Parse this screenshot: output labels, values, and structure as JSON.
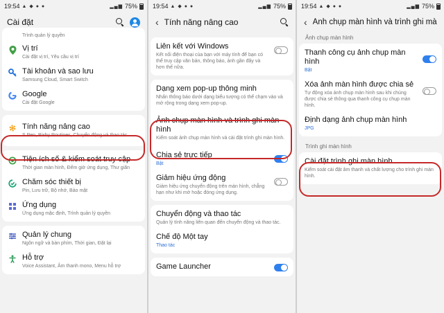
{
  "colors": {
    "highlight": "#c62828",
    "toggle_on": "#2f80ed",
    "subtitle_blue": "#2a6fd6"
  },
  "panels": [
    {
      "status": {
        "time": "19:54",
        "battery": "75%"
      },
      "header": {
        "title": "Cài đặt"
      },
      "items": [
        {
          "title": "",
          "subtitle": "Trình quản lý quyền"
        },
        {
          "title": "Vị trí",
          "subtitle": "Cài đặt vị trí, Yêu cầu vị trí",
          "icon": "location-icon"
        },
        {
          "title": "Tài khoản và sao lưu",
          "subtitle": "Samsung Cloud, Smart Switch",
          "icon": "key-icon"
        },
        {
          "title": "Google",
          "subtitle": "Cài đặt Google",
          "icon": "google-icon"
        },
        {
          "title": "Tính năng nâng cao",
          "subtitle": "S Pen, Bixby Routines, Chuyển động và thao tác",
          "icon": "advanced-features-icon"
        },
        {
          "title": "Tiện ích số & kiểm soát truy cập",
          "subtitle": "Thời gian màn hình, Đếm giờ ứng dụng, Thư giãn",
          "icon": "digital-wellbeing-icon"
        },
        {
          "title": "Chăm sóc thiết bị",
          "subtitle": "Pin, Lưu trữ, Bộ nhớ, Bảo mật",
          "icon": "device-care-icon"
        },
        {
          "title": "Ứng dụng",
          "subtitle": "Ứng dụng mặc định, Trình quản lý quyền",
          "icon": "apps-icon"
        },
        {
          "title": "Quản lý chung",
          "subtitle": "Ngôn ngữ và bàn phím, Thời gian, Đặt lại",
          "icon": "general-management-icon"
        },
        {
          "title": "Hỗ trợ",
          "subtitle": "Voice Assistant, Âm thanh mono, Menu hỗ trợ",
          "icon": "accessibility-icon"
        }
      ]
    },
    {
      "status": {
        "time": "19:54",
        "battery": "75%"
      },
      "header": {
        "title": "Tính năng nâng cao"
      },
      "items": [
        {
          "title": "Liên kết với Windows",
          "subtitle": "Kết nối điện thoại của bạn với máy tính để bạn có thể truy cập văn bản, thông báo, ảnh gần đây và hơn thế nữa."
        },
        {
          "title": "Dạng xem pop-up thông minh",
          "subtitle": "Nhấn thông báo dưới dạng biểu tượng có thể chạm vào và mở rộng trong dạng xem pop-up."
        },
        {
          "title": "Ảnh chụp màn hình và trình ghi màn hình",
          "subtitle": "Kiểm soát ảnh chụp màn hình và cài đặt trình ghi màn hình."
        },
        {
          "title": "Chia sẻ trực tiếp",
          "subtitle": "Bật"
        },
        {
          "title": "Giảm hiệu ứng động",
          "subtitle": "Giảm hiệu ứng chuyển động trên màn hình, chẳng hạn như khi mở hoặc đóng ứng dụng."
        },
        {
          "title": "Chuyển động và thao tác",
          "subtitle": "Quản lý tính năng liên quan đến chuyển động và thao tác."
        },
        {
          "title": "Chế độ Một tay",
          "subtitle": "Thao tác"
        },
        {
          "title": "Game Launcher",
          "subtitle": ""
        }
      ]
    },
    {
      "status": {
        "time": "19:54",
        "battery": "75%"
      },
      "header": {
        "title": "Ảnh chụp màn hình và trình ghi màn hình"
      },
      "sections": [
        {
          "label": "Ảnh chụp màn hình",
          "items": [
            {
              "title": "Thanh công cụ ảnh chụp màn hình",
              "subtitle": "Bật"
            },
            {
              "title": "Xóa ảnh màn hình được chia sẻ",
              "subtitle": "Tự động xóa ảnh chụp màn hình sau khi chúng được chia sẻ thông qua thanh công cụ chụp màn hình."
            },
            {
              "title": "Định dạng ảnh chụp màn hình",
              "subtitle": "JPG"
            }
          ]
        },
        {
          "label": "Trình ghi màn hình",
          "items": [
            {
              "title": "Cài đặt trình ghi màn hình",
              "subtitle": "Kiểm soát cài đặt âm thanh và chất lượng cho trình ghi màn hình."
            }
          ]
        }
      ]
    }
  ]
}
